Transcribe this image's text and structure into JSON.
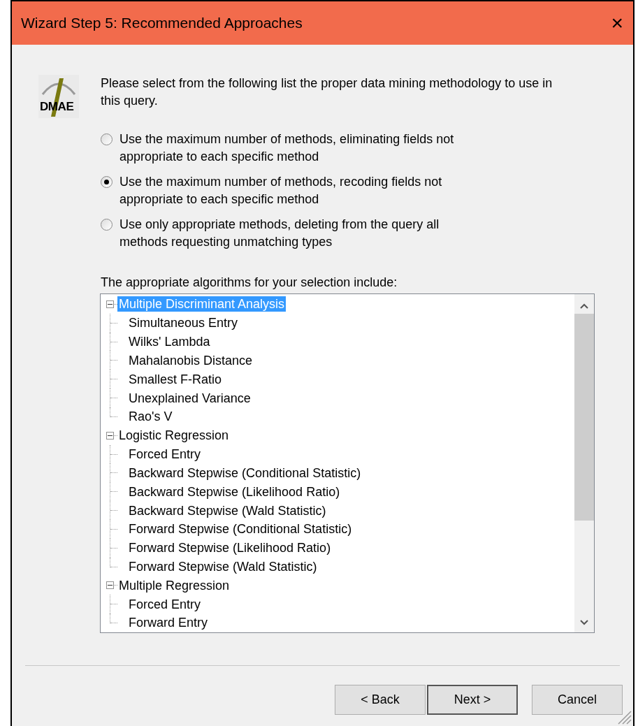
{
  "window": {
    "title": "Wizard Step 5: Recommended Approaches",
    "close": "×"
  },
  "logo": {
    "text": "DMAE"
  },
  "intro": "Please select from the following list the proper data mining methodology to use in this query.",
  "options": [
    {
      "label": "Use the maximum number of methods, eliminating fields not appropriate to each specific method",
      "selected": false
    },
    {
      "label": "Use the maximum number of methods, recoding fields not appropriate to each specific method",
      "selected": true
    },
    {
      "label": "Use only appropriate methods, deleting from the query all methods requesting unmatching types",
      "selected": false
    }
  ],
  "tree_label": "The appropriate algorithms for your selection include:",
  "tree": [
    {
      "label": "Multiple Discriminant Analysis",
      "selected": true,
      "expanded": true,
      "children": [
        {
          "label": "Simultaneous Entry",
          "selected": false
        },
        {
          "label": "Wilks' Lambda",
          "selected": false
        },
        {
          "label": "Mahalanobis Distance",
          "selected": false
        },
        {
          "label": "Smallest F-Ratio",
          "selected": false
        },
        {
          "label": "Unexplained Variance",
          "selected": false
        },
        {
          "label": "Rao's V",
          "selected": false
        }
      ]
    },
    {
      "label": "Logistic Regression",
      "selected": false,
      "expanded": true,
      "children": [
        {
          "label": "Forced Entry",
          "selected": false
        },
        {
          "label": "Backward Stepwise (Conditional Statistic)",
          "selected": false
        },
        {
          "label": "Backward Stepwise (Likelihood Ratio)",
          "selected": false
        },
        {
          "label": "Backward Stepwise (Wald Statistic)",
          "selected": false
        },
        {
          "label": "Forward Stepwise (Conditional Statistic)",
          "selected": false
        },
        {
          "label": "Forward Stepwise (Likelihood Ratio)",
          "selected": false
        },
        {
          "label": "Forward Stepwise (Wald Statistic)",
          "selected": false
        }
      ]
    },
    {
      "label": "Multiple Regression",
      "selected": false,
      "expanded": true,
      "children": [
        {
          "label": "Forced Entry",
          "selected": false
        },
        {
          "label": "Forward Entry",
          "selected": false
        }
      ]
    }
  ],
  "buttons": [
    {
      "label": "< Back",
      "default": false
    },
    {
      "label": "Next >",
      "default": true
    },
    {
      "label": "Cancel",
      "default": false
    }
  ]
}
